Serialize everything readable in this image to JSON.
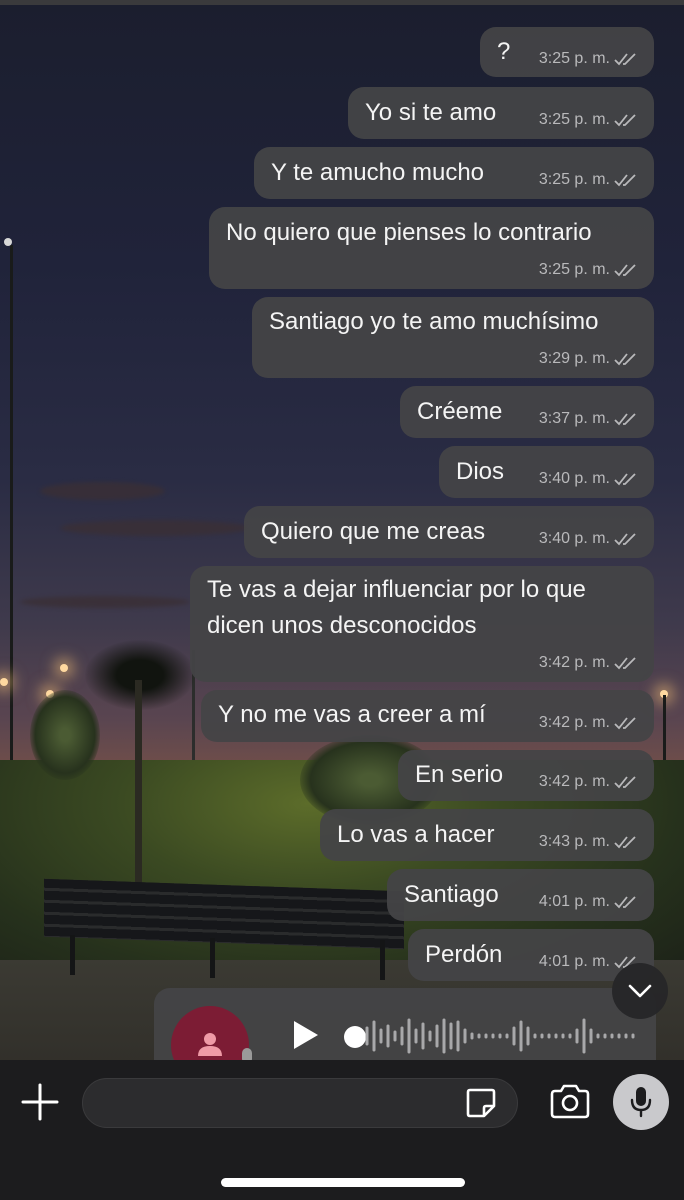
{
  "messages": [
    {
      "text": "?",
      "time": "3:25 p. m.",
      "status": "read"
    },
    {
      "text": "Yo si te amo",
      "time": "3:25 p. m.",
      "status": "read"
    },
    {
      "text": "Y te amucho mucho",
      "time": "3:25 p. m.",
      "status": "read"
    },
    {
      "text": "No quiero que pienses lo contrario",
      "time": "3:25 p. m.",
      "status": "read"
    },
    {
      "text": "Santiago yo te amo muchísimo",
      "time": "3:29 p. m.",
      "status": "read"
    },
    {
      "text": "Créeme",
      "time": "3:37 p. m.",
      "status": "read"
    },
    {
      "text": "Dios",
      "time": "3:40 p. m.",
      "status": "read"
    },
    {
      "text": "Quiero que me creas",
      "time": "3:40 p. m.",
      "status": "read"
    },
    {
      "text_line1": "Te vas a dejar influenciar por lo que",
      "text_line2": "dicen unos desconocidos",
      "time": "3:42 p. m.",
      "status": "read"
    },
    {
      "text": "Y no me vas a creer a mí",
      "time": "3:42 p. m.",
      "status": "read"
    },
    {
      "text": "En serio",
      "time": "3:42 p. m.",
      "status": "read"
    },
    {
      "text": "Lo vas a hacer",
      "time": "3:43 p. m.",
      "status": "read"
    },
    {
      "text": "Santiago",
      "time": "4:01 p. m.",
      "status": "read"
    },
    {
      "text": "Perdón",
      "time": "4:01 p. m.",
      "status": "read"
    }
  ],
  "voice_message": {
    "avatar_icon": "person-icon",
    "avatar_color": "#7c1c34",
    "play_icon": "play-icon",
    "progress": 0.0
  },
  "composer": {
    "placeholder": "",
    "plus_icon": "plus-icon",
    "sticker_icon": "sticker-icon",
    "camera_icon": "camera-icon",
    "mic_icon": "microphone-icon"
  },
  "scroll_down_icon": "chevron-down-icon",
  "colors": {
    "bubble": "#444446",
    "text": "#f4f4f4",
    "meta": "#b9b9bb",
    "input_bar": "#1c1c1e"
  }
}
